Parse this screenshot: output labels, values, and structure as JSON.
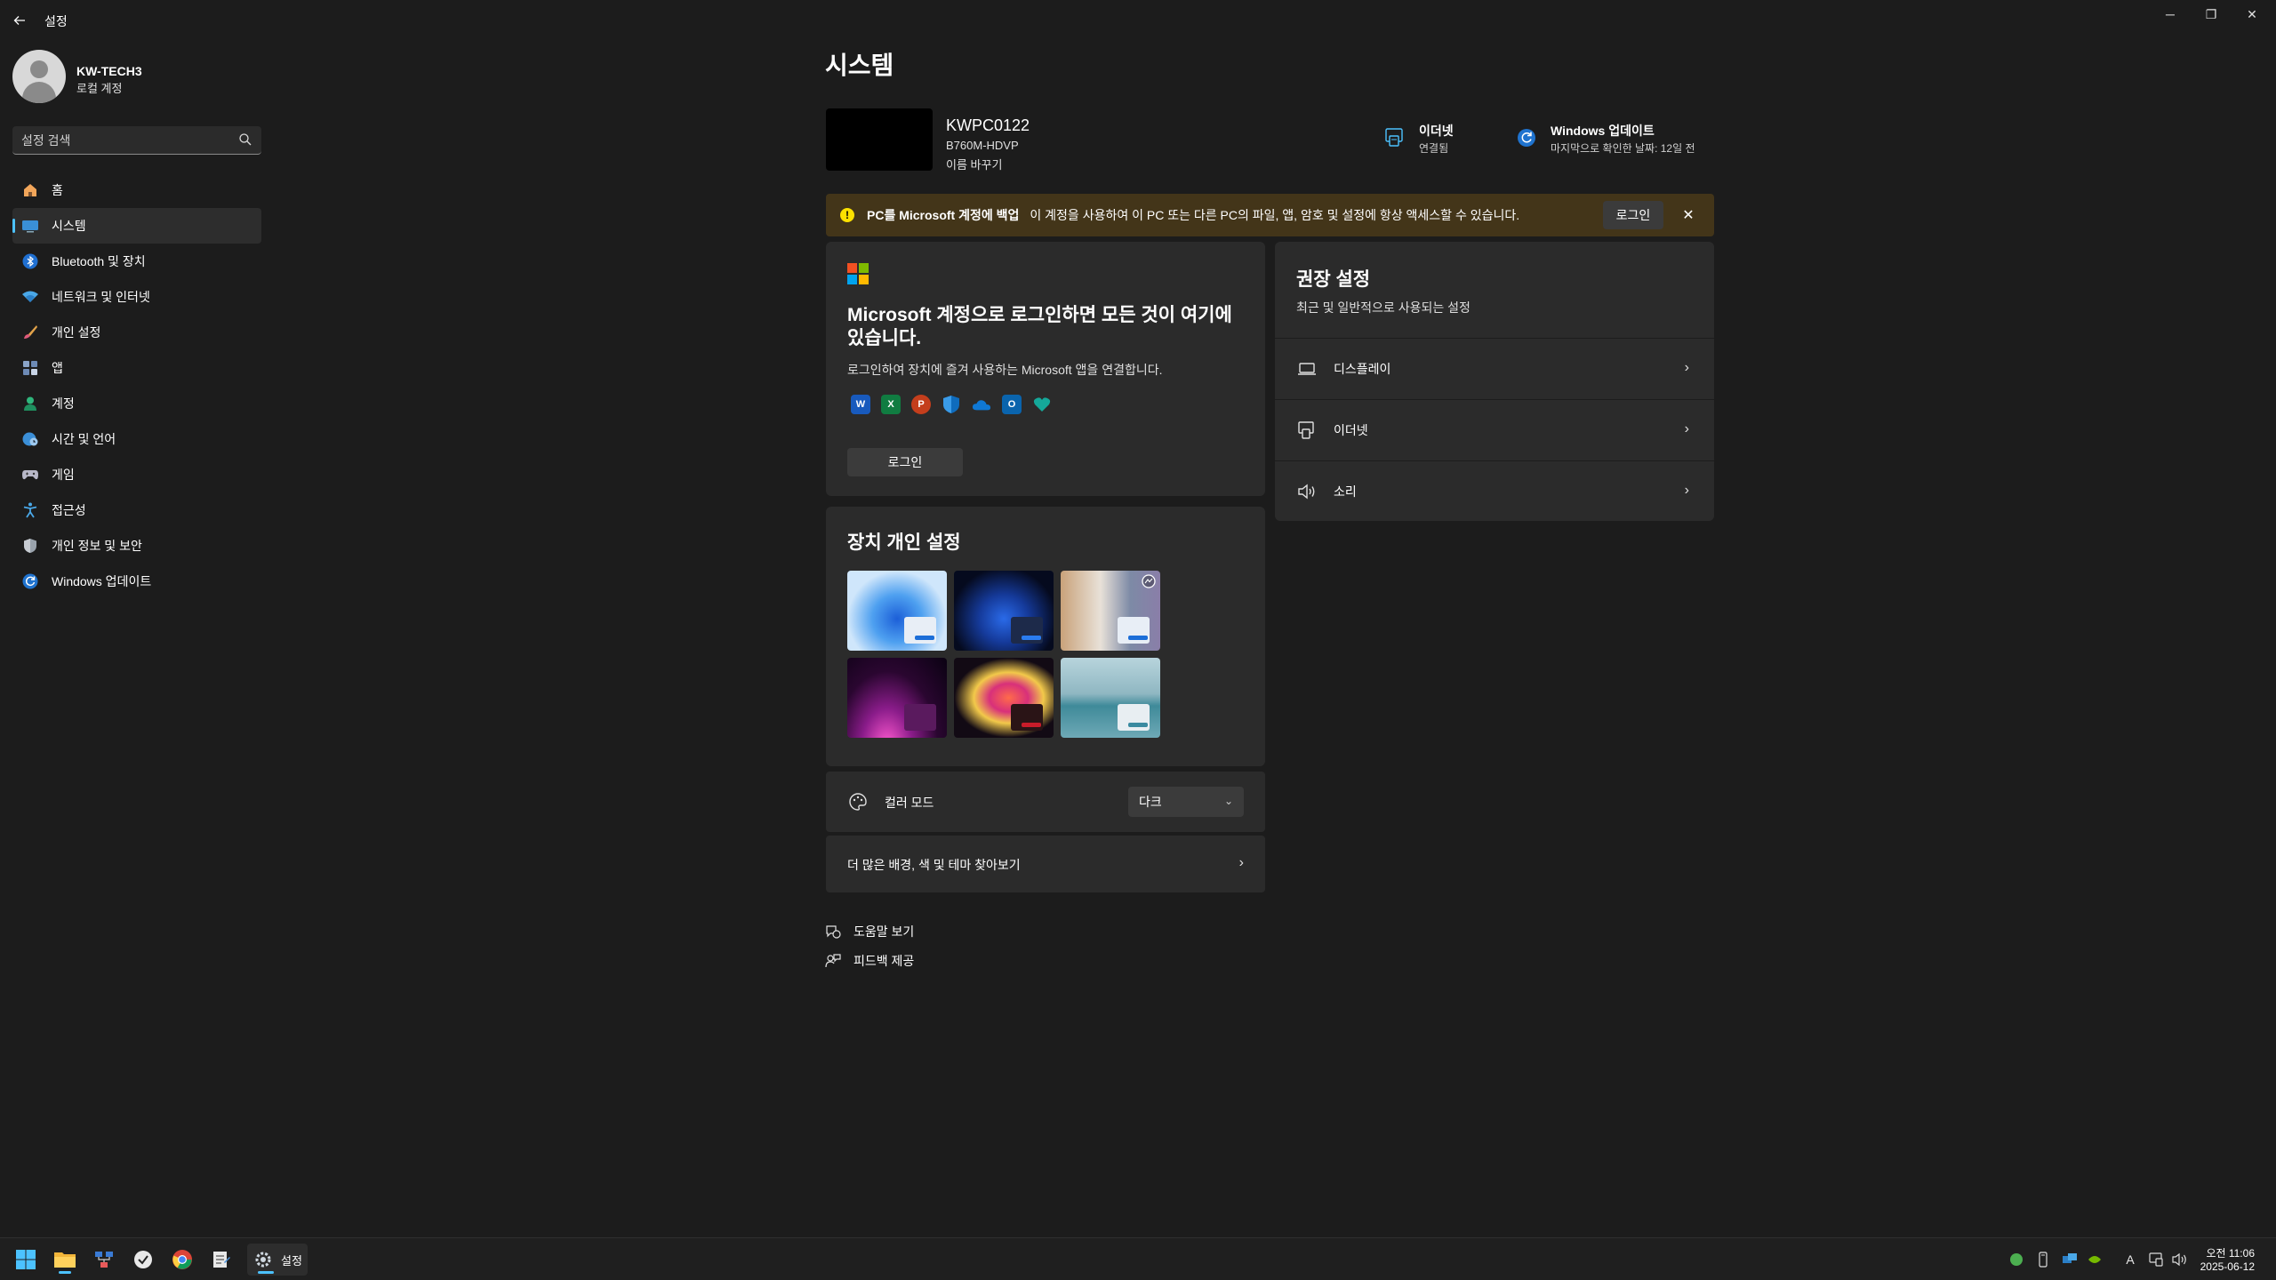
{
  "window": {
    "title": "설정",
    "minimize_glyph": "─",
    "restore_glyph": "❐",
    "close_glyph": "✕"
  },
  "user": {
    "name": "KW-TECH3",
    "account_type": "로컬 계정"
  },
  "search": {
    "placeholder": "설정 검색"
  },
  "nav": {
    "items": [
      {
        "label": "홈",
        "icon": "home-icon"
      },
      {
        "label": "시스템",
        "icon": "system-icon"
      },
      {
        "label": "Bluetooth 및 장치",
        "icon": "bluetooth-icon"
      },
      {
        "label": "네트워크 및 인터넷",
        "icon": "wifi-icon"
      },
      {
        "label": "개인 설정",
        "icon": "brush-icon"
      },
      {
        "label": "앱",
        "icon": "apps-icon"
      },
      {
        "label": "계정",
        "icon": "account-icon"
      },
      {
        "label": "시간 및 언어",
        "icon": "globe-clock-icon"
      },
      {
        "label": "게임",
        "icon": "gamepad-icon"
      },
      {
        "label": "접근성",
        "icon": "accessibility-icon"
      },
      {
        "label": "개인 정보 및 보안",
        "icon": "shield-icon"
      },
      {
        "label": "Windows 업데이트",
        "icon": "update-icon"
      }
    ],
    "selected_index": 1
  },
  "main": {
    "title": "시스템",
    "pc": {
      "name": "KWPC0122",
      "model": "B760M-HDVP",
      "rename": "이름 바꾸기"
    },
    "status": {
      "ethernet_title": "이더넷",
      "ethernet_status": "연결됨",
      "update_title": "Windows 업데이트",
      "update_status": "마지막으로 확인한 날짜: 12일 전"
    },
    "banner": {
      "title": "PC를 Microsoft 계정에 백업",
      "text": "이 계정을 사용하여 이 PC 또는 다른 PC의 파일, 앱, 암호 및 설정에 항상 액세스할 수 있습니다.",
      "login_button": "로그인",
      "close_glyph": "✕"
    },
    "ms_card": {
      "heading": "Microsoft 계정으로 로그인하면 모든 것이 여기에 있습니다.",
      "description": "로그인하여 장치에 즐겨 사용하는 Microsoft 앱을 연결합니다.",
      "apps": [
        {
          "name": "word-icon",
          "letter": "W",
          "color": "#185abd"
        },
        {
          "name": "excel-icon",
          "letter": "X",
          "color": "#107c41"
        },
        {
          "name": "powerpoint-icon",
          "letter": "P",
          "color": "#c43e1c"
        },
        {
          "name": "defender-icon",
          "letter": "",
          "color": "#0f6cbd"
        },
        {
          "name": "onedrive-icon",
          "letter": "",
          "color": "#0f78d4"
        },
        {
          "name": "outlook-icon",
          "letter": "O",
          "color": "#0a64ad"
        },
        {
          "name": "family-safety-icon",
          "letter": "",
          "color": "#15a89a"
        }
      ],
      "login_button": "로그인"
    },
    "recommended": {
      "title": "권장 설정",
      "subtitle": "최근 및 일반적으로 사용되는 설정",
      "items": [
        {
          "label": "디스플레이",
          "icon": "laptop-icon"
        },
        {
          "label": "이더넷",
          "icon": "ethernet-icon"
        },
        {
          "label": "소리",
          "icon": "speaker-icon"
        }
      ]
    },
    "device": {
      "title": "장치 개인 설정",
      "color_mode_label": "컬러 모드",
      "color_mode_value": "다크",
      "more_link": "더 많은 배경, 색 및 테마 찾아보기"
    },
    "help": "도움말 보기",
    "feedback": "피드백 제공"
  },
  "taskbar": {
    "settings_label": "설정",
    "time": "오전 11:06",
    "date": "2025-06-12",
    "ime": "A"
  },
  "colors": {
    "accent": "#4cc2ff",
    "background": "#1c1c1c",
    "card": "#2b2b2b",
    "banner": "#433519"
  }
}
